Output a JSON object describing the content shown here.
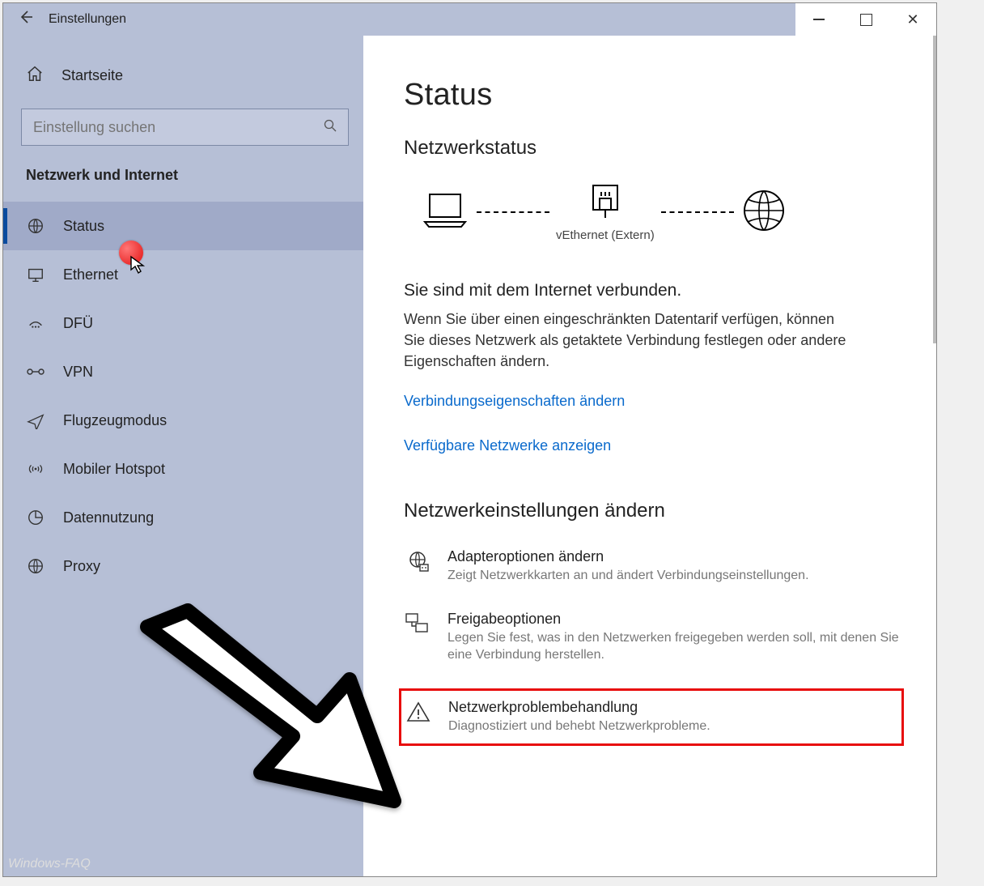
{
  "window": {
    "title": "Einstellungen"
  },
  "sidebar": {
    "home_label": "Startseite",
    "search_placeholder": "Einstellung suchen",
    "section_title": "Netzwerk und Internet",
    "items": [
      {
        "icon": "globe-wire-icon",
        "label": "Status",
        "selected": true
      },
      {
        "icon": "monitor-icon",
        "label": "Ethernet",
        "selected": false
      },
      {
        "icon": "dialup-icon",
        "label": "DFÜ",
        "selected": false
      },
      {
        "icon": "vpn-icon",
        "label": "VPN",
        "selected": false
      },
      {
        "icon": "airplane-icon",
        "label": "Flugzeugmodus",
        "selected": false
      },
      {
        "icon": "hotspot-icon",
        "label": "Mobiler Hotspot",
        "selected": false
      },
      {
        "icon": "data-usage-icon",
        "label": "Datennutzung",
        "selected": false
      },
      {
        "icon": "globe-icon",
        "label": "Proxy",
        "selected": false
      }
    ]
  },
  "main": {
    "heading": "Status",
    "subheading": "Netzwerkstatus",
    "diagram_connection_label": "vEthernet (Extern)",
    "connected_title": "Sie sind mit dem Internet verbunden.",
    "connected_body": "Wenn Sie über einen eingeschränkten Datentarif verfügen, können Sie dieses Netzwerk als getaktete Verbindung festlegen oder andere Eigenschaften ändern.",
    "link_change_props": "Verbindungseigenschaften ändern",
    "link_show_networks": "Verfügbare Netzwerke anzeigen",
    "change_settings_heading": "Netzwerkeinstellungen ändern",
    "options": [
      {
        "icon": "adapter-icon",
        "title": "Adapteroptionen ändern",
        "desc": "Zeigt Netzwerkkarten an und ändert Verbindungseinstellungen."
      },
      {
        "icon": "sharing-icon",
        "title": "Freigabeoptionen",
        "desc": "Legen Sie fest, was in den Netzwerken freigegeben werden soll, mit denen Sie eine Verbindung herstellen."
      },
      {
        "icon": "warning-icon",
        "title": "Netzwerkproblembehandlung",
        "desc": "Diagnostiziert und behebt Netzwerkprobleme."
      }
    ]
  },
  "annotation": {
    "highlighted_option_index": 2,
    "red_dot_on": "Status",
    "arrow_points_to": "Netzwerkproblembehandlung"
  },
  "watermark": "Windows-FAQ"
}
